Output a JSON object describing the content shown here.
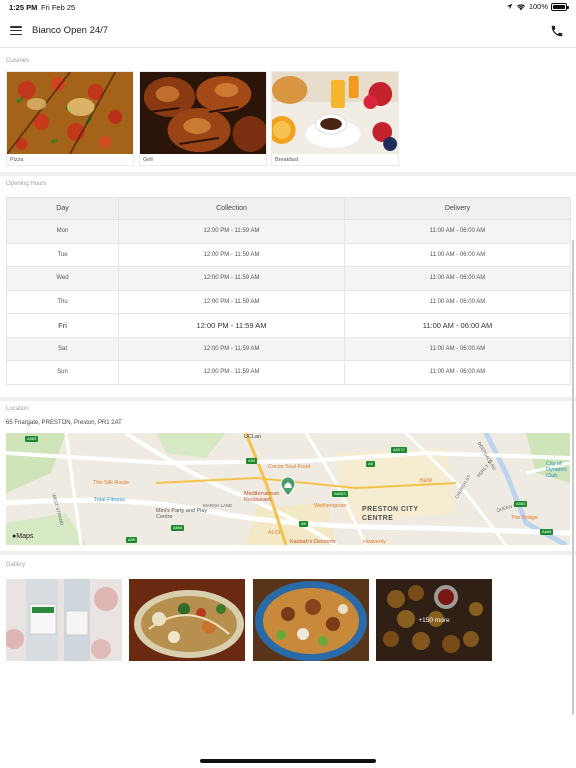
{
  "status_bar": {
    "time": "1:25 PM",
    "date": "Fri Feb 25",
    "battery": "100%"
  },
  "header": {
    "title": "Bianco Open 24/7",
    "menu_icon": "hamburger-menu-icon",
    "call_icon": "phone-icon"
  },
  "cuisines": {
    "label": "Cuisines",
    "items": [
      {
        "name": "Pizza"
      },
      {
        "name": "Grill"
      },
      {
        "name": "Breakfast"
      }
    ]
  },
  "opening_hours": {
    "label": "Opening Hours",
    "columns": [
      "Day",
      "Collection",
      "Delivery"
    ],
    "rows": [
      {
        "day": "Mon",
        "collection": "12:00 PM - 11:59 AM",
        "delivery": "11:00 AM - 06:00 AM"
      },
      {
        "day": "Tue",
        "collection": "12:00 PM - 11:59 AM",
        "delivery": "11:00 AM - 06:00 AM"
      },
      {
        "day": "Wed",
        "collection": "12:00 PM - 11:59 AM",
        "delivery": "11:00 AM - 06:00 AM"
      },
      {
        "day": "Thu",
        "collection": "12:00 PM - 11:59 AM",
        "delivery": "11:00 AM - 06:00 AM"
      },
      {
        "day": "Fri",
        "collection": "12:00 PM - 11:59 AM",
        "delivery": "11:00 AM - 06:00 AM"
      },
      {
        "day": "Sat",
        "collection": "12:00 PM - 11:59 AM",
        "delivery": "11:00 AM - 06:00 AM"
      },
      {
        "day": "Sun",
        "collection": "12:00 PM - 11:59 AM",
        "delivery": "11:00 AM - 06:00 AM"
      }
    ],
    "today": "Fri"
  },
  "location": {
    "label": "Location",
    "address": "65 Friargate, PRESTON, Preston, PR1 2AT",
    "map": {
      "attribution": "Maps",
      "places": [
        "UCLan",
        "The Silk Route",
        "Total Fitness",
        "Mini's Party and Play Centre",
        "Cocos Soul Food",
        "Mediterranean Restaurant",
        "Wetherspoon",
        "B&M",
        "ALDI",
        "Kasbah's Desserts",
        "Heavenly",
        "The Bridge",
        "City of Dynamic Club"
      ],
      "districts": [
        "PRESTON CITY CENTRE"
      ],
      "streets": [
        "WEST STRAND",
        "MARSH LANE",
        "CHURCH ST",
        "PERCY ST",
        "DEEPDALE RD",
        "QUEEN ST"
      ],
      "roads": [
        "A583",
        "A59",
        "A6",
        "A5072",
        "A6063",
        "A666",
        "A59",
        "A583",
        "A6",
        "A666"
      ]
    }
  },
  "gallery": {
    "label": "Gallery",
    "more_label": "+150 more"
  },
  "colors": {
    "accent": "#e8762d",
    "map_road_green": "#1a8a2a",
    "pin": "#4a9a6a"
  }
}
